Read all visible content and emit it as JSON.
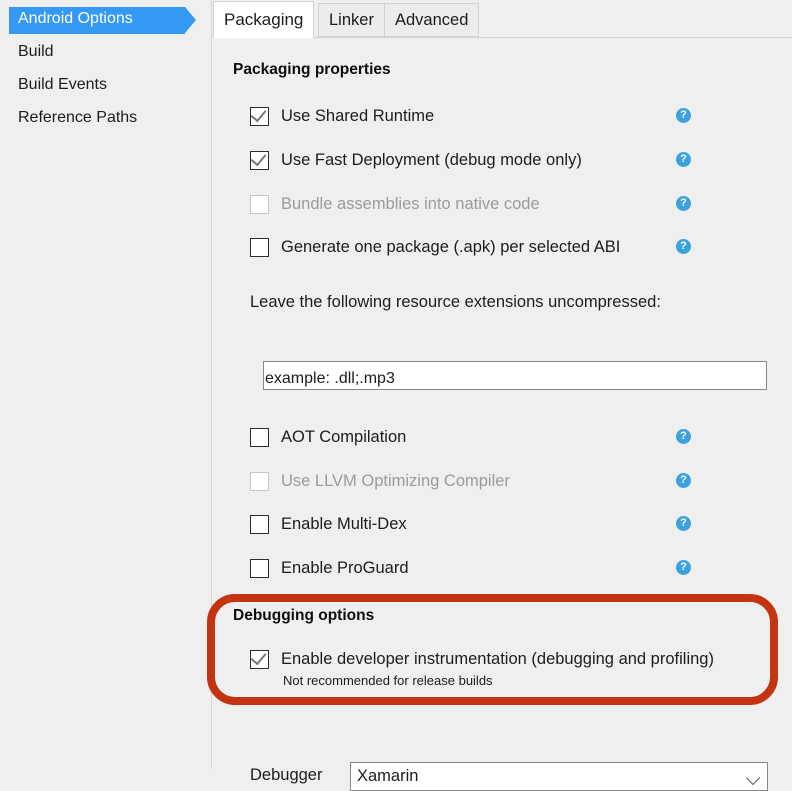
{
  "sidebar": {
    "items": [
      {
        "label": "Android Options",
        "selected": true
      },
      {
        "label": "Build",
        "selected": false
      },
      {
        "label": "Build Events",
        "selected": false
      },
      {
        "label": "Reference Paths",
        "selected": false
      }
    ]
  },
  "tabs": [
    {
      "label": "Packaging",
      "active": true
    },
    {
      "label": "Linker",
      "active": false
    },
    {
      "label": "Advanced",
      "active": false
    }
  ],
  "packaging": {
    "group_title": "Packaging properties",
    "options": [
      {
        "label": "Use Shared Runtime",
        "checked": true,
        "disabled": false,
        "help": true
      },
      {
        "label": "Use Fast Deployment (debug mode only)",
        "checked": true,
        "disabled": false,
        "help": true
      },
      {
        "label": "Bundle assemblies into native code",
        "checked": false,
        "disabled": true,
        "help": true
      },
      {
        "label": "Generate one package (.apk) per selected ABI",
        "checked": false,
        "disabled": false,
        "help": true
      }
    ],
    "extensions_label": "Leave the following resource extensions uncompressed:",
    "extensions_value": "",
    "extensions_placeholder": "",
    "extensions_example": "example: .dll;.mp3",
    "options2": [
      {
        "label": "AOT Compilation",
        "checked": false,
        "disabled": false,
        "help": true
      },
      {
        "label": "Use LLVM Optimizing Compiler",
        "checked": false,
        "disabled": true,
        "help": true
      },
      {
        "label": "Enable Multi-Dex",
        "checked": false,
        "disabled": false,
        "help": true
      },
      {
        "label": "Enable ProGuard",
        "checked": false,
        "disabled": false,
        "help": true
      }
    ]
  },
  "debugging": {
    "group_title": "Debugging options",
    "instrumentation_label": "Enable developer instrumentation (debugging and profiling)",
    "instrumentation_checked": true,
    "instrumentation_note": "Not recommended for release builds",
    "debugger_label": "Debugger",
    "debugger_value": "Xamarin",
    "debugger_options": [
      "Xamarin"
    ]
  },
  "icons": {
    "help": "?",
    "help_name": "help-icon",
    "chevron_down": "chevron-down-icon"
  },
  "colors": {
    "selection_blue": "#3399f3",
    "help_blue": "#3aa3dc",
    "annotation_red": "#c23412",
    "panel_bg": "#efefef",
    "disabled_text": "#9b9b9b"
  },
  "annotation": {
    "shape": "rounded-rectangle-highlight",
    "target": "Debugging options"
  }
}
